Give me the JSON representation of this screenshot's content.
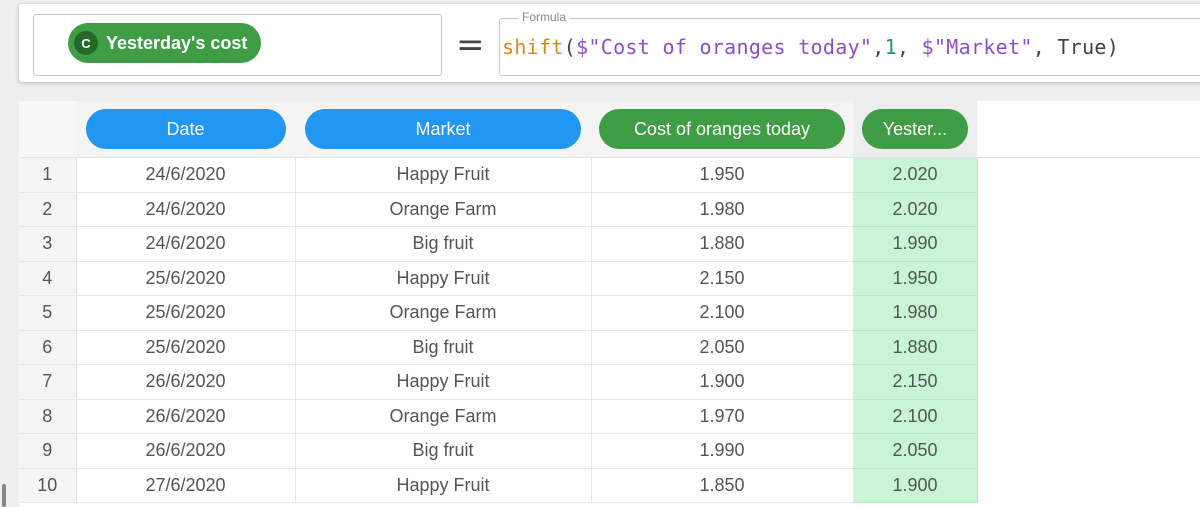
{
  "formula_bar": {
    "column_type": "C",
    "column_name": "Yesterday's cost",
    "equals": "=",
    "formula_label": "Formula",
    "formula_tokens": {
      "fn": "shift",
      "open": "(",
      "arg1": "$\"Cost of oranges today\"",
      "comma1": ",",
      "arg2": "1",
      "comma2": ", ",
      "arg3": "$\"Market\"",
      "comma3": ", ",
      "arg4": "True",
      "close": ")"
    },
    "colors": {
      "pill": "#3f9d45",
      "function": "#d58a1d",
      "string": "#8c4fc8",
      "number": "#1f9a61"
    }
  },
  "table": {
    "columns": [
      {
        "label": "Date",
        "color": "blue"
      },
      {
        "label": "Market",
        "color": "blue"
      },
      {
        "label": "Cost of oranges today",
        "color": "green"
      },
      {
        "label": "Yester...",
        "color": "green"
      }
    ],
    "rows": [
      {
        "n": "1",
        "date": "24/6/2020",
        "market": "Happy Fruit",
        "cost": "1.950",
        "yesterday": "2.020"
      },
      {
        "n": "2",
        "date": "24/6/2020",
        "market": "Orange Farm",
        "cost": "1.980",
        "yesterday": "2.020"
      },
      {
        "n": "3",
        "date": "24/6/2020",
        "market": "Big fruit",
        "cost": "1.880",
        "yesterday": "1.990"
      },
      {
        "n": "4",
        "date": "25/6/2020",
        "market": "Happy Fruit",
        "cost": "2.150",
        "yesterday": "1.950"
      },
      {
        "n": "5",
        "date": "25/6/2020",
        "market": "Orange Farm",
        "cost": "2.100",
        "yesterday": "1.980"
      },
      {
        "n": "6",
        "date": "25/6/2020",
        "market": "Big fruit",
        "cost": "2.050",
        "yesterday": "1.880"
      },
      {
        "n": "7",
        "date": "26/6/2020",
        "market": "Happy Fruit",
        "cost": "1.900",
        "yesterday": "2.150"
      },
      {
        "n": "8",
        "date": "26/6/2020",
        "market": "Orange Farm",
        "cost": "1.970",
        "yesterday": "2.100"
      },
      {
        "n": "9",
        "date": "26/6/2020",
        "market": "Big fruit",
        "cost": "1.990",
        "yesterday": "2.050"
      },
      {
        "n": "10",
        "date": "27/6/2020",
        "market": "Happy Fruit",
        "cost": "1.850",
        "yesterday": "1.900"
      }
    ],
    "colors": {
      "blue_header": "#2196f3",
      "green_header": "#3f9d45",
      "new_column_fill": "#c7f5d5"
    }
  }
}
